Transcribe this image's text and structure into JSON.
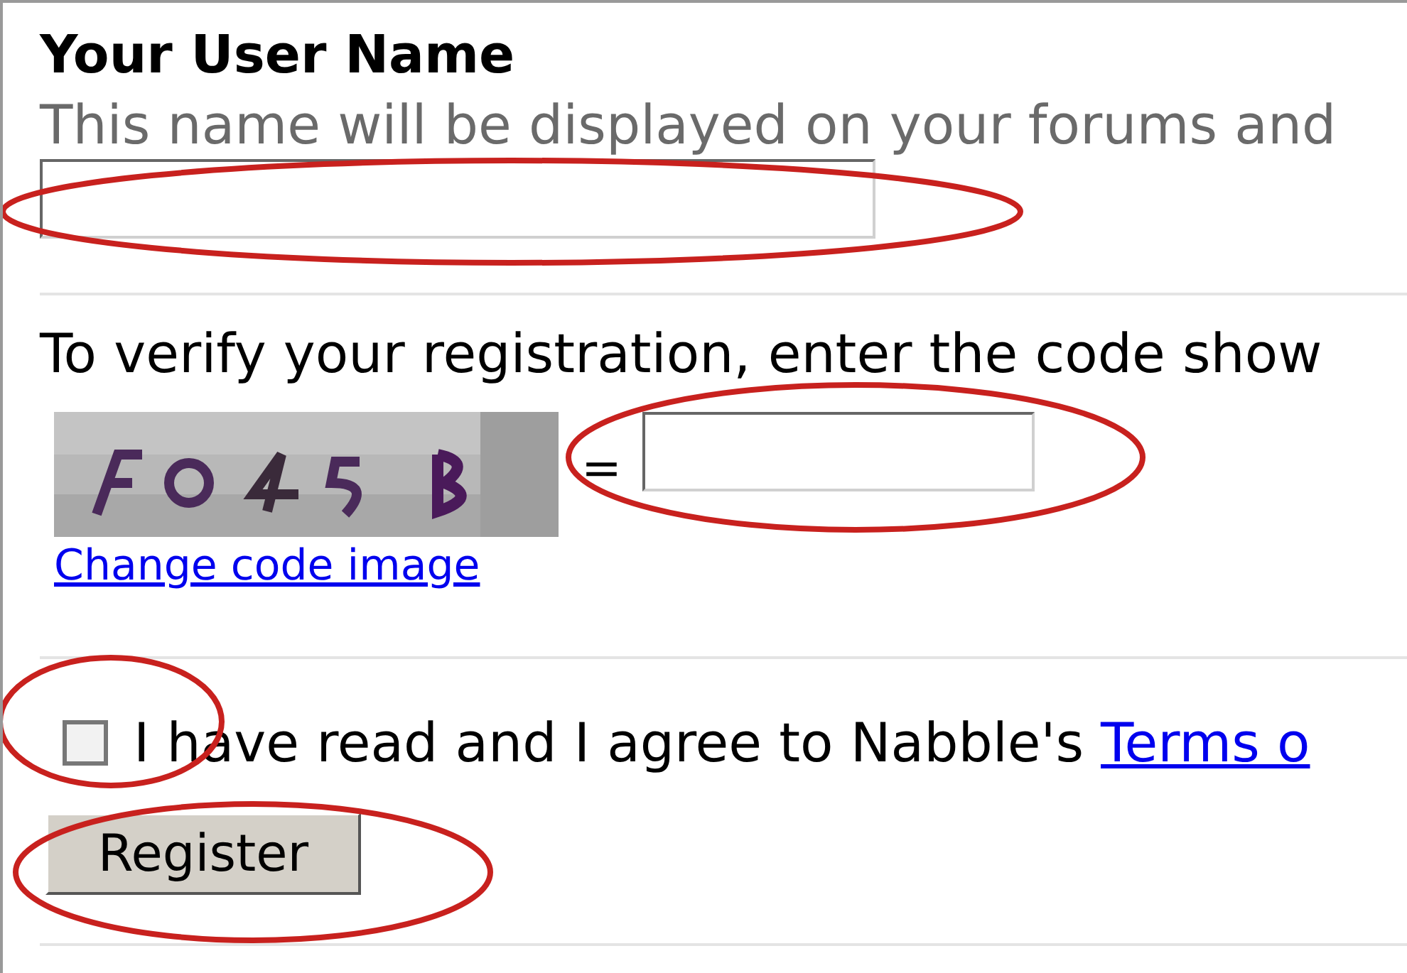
{
  "username_section": {
    "heading": "Your User Name",
    "hint": "This name will be displayed on your forums and"
  },
  "verify_section": {
    "instruction": "To verify your registration, enter the code show",
    "equals": "=",
    "change_link": "Change code image"
  },
  "terms": {
    "checked": false,
    "text": "I have read and I agree to Nabble's",
    "link": "Terms o"
  },
  "register_button": "Register"
}
